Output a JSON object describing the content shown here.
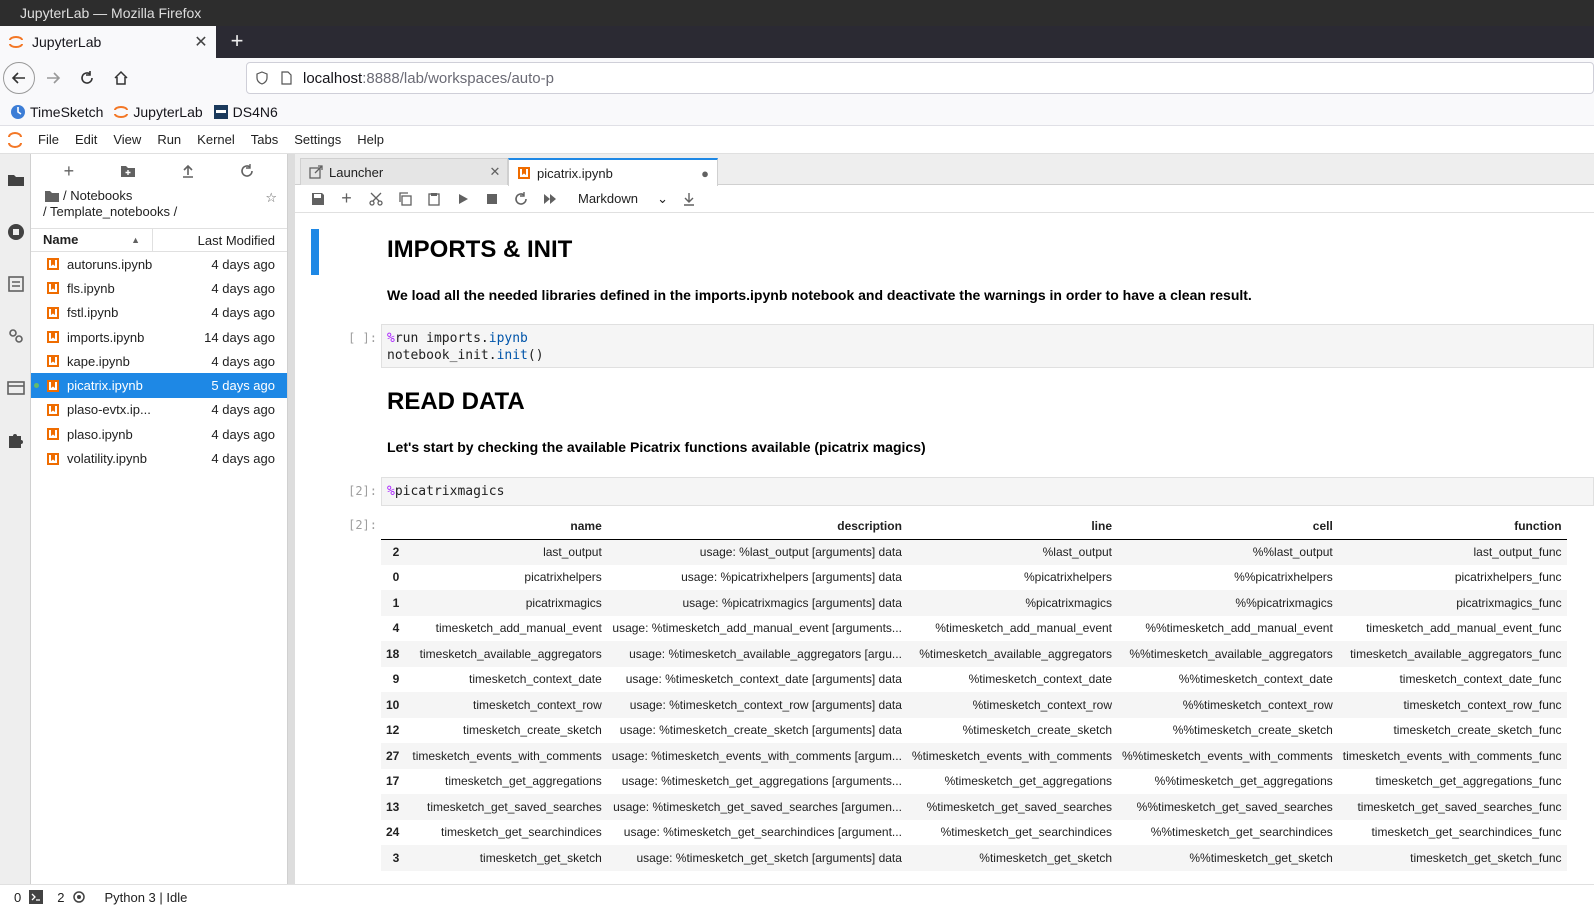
{
  "window": {
    "title": "JupyterLab — Mozilla Firefox"
  },
  "browser": {
    "tab_title": "JupyterLab",
    "url_host": "localhost",
    "url_rest": ":8888/lab/workspaces/auto-p",
    "bookmarks": [
      {
        "label": "TimeSketch",
        "icon": "timesketch-icon"
      },
      {
        "label": "JupyterLab",
        "icon": "jupyter-icon"
      },
      {
        "label": "DS4N6",
        "icon": "ds4n6-icon"
      }
    ]
  },
  "menu": [
    "File",
    "Edit",
    "View",
    "Run",
    "Kernel",
    "Tabs",
    "Settings",
    "Help"
  ],
  "filebrowser": {
    "crumb_line1": "/ Notebooks",
    "crumb_line2": "/ Template_notebooks /",
    "col_name": "Name",
    "col_modified": "Last Modified",
    "files": [
      {
        "name": "autoruns.ipynb",
        "modified": "4 days ago"
      },
      {
        "name": "fls.ipynb",
        "modified": "4 days ago"
      },
      {
        "name": "fstl.ipynb",
        "modified": "4 days ago"
      },
      {
        "name": "imports.ipynb",
        "modified": "14 days ago"
      },
      {
        "name": "kape.ipynb",
        "modified": "4 days ago"
      },
      {
        "name": "picatrix.ipynb",
        "modified": "5 days ago"
      },
      {
        "name": "plaso-evtx.ip...",
        "modified": "4 days ago"
      },
      {
        "name": "plaso.ipynb",
        "modified": "4 days ago"
      },
      {
        "name": "volatility.ipynb",
        "modified": "4 days ago"
      }
    ]
  },
  "doc_tabs": [
    {
      "label": "Launcher"
    },
    {
      "label": "picatrix.ipynb"
    }
  ],
  "notebook": {
    "cell_type": "Markdown",
    "h1_imports": "IMPORTS & INIT",
    "p_imports": "We load all the needed libraries defined in the imports.ipynb notebook and deactivate the warnings in order to have a clean result.",
    "prompt_empty": "[ ]:",
    "code1_magic": "%",
    "code1_a": "run imports.",
    "code1_b": "ipynb",
    "code1_c": "notebook_init.",
    "code1_d": "init",
    "code1_e": "()",
    "h1_read": "READ DATA",
    "p_read": "Let's start by checking the available Picatrix functions available (picatrix magics)",
    "prompt_2": "[2]:",
    "code2_magic": "%",
    "code2_rest": "picatrixmagics",
    "out_prompt": "[2]:"
  },
  "output_table": {
    "columns": [
      "name",
      "description",
      "line",
      "cell",
      "function"
    ],
    "rows": [
      [
        "2",
        "last_output",
        "usage: %last_output [arguments] data",
        "%last_output",
        "%%last_output",
        "last_output_func"
      ],
      [
        "0",
        "picatrixhelpers",
        "usage: %picatrixhelpers [arguments] data",
        "%picatrixhelpers",
        "%%picatrixhelpers",
        "picatrixhelpers_func"
      ],
      [
        "1",
        "picatrixmagics",
        "usage: %picatrixmagics [arguments] data",
        "%picatrixmagics",
        "%%picatrixmagics",
        "picatrixmagics_func"
      ],
      [
        "4",
        "timesketch_add_manual_event",
        "usage: %timesketch_add_manual_event [arguments...",
        "%timesketch_add_manual_event",
        "%%timesketch_add_manual_event",
        "timesketch_add_manual_event_func"
      ],
      [
        "18",
        "timesketch_available_aggregators",
        "usage: %timesketch_available_aggregators [argu...",
        "%timesketch_available_aggregators",
        "%%timesketch_available_aggregators",
        "timesketch_available_aggregators_func"
      ],
      [
        "9",
        "timesketch_context_date",
        "usage: %timesketch_context_date [arguments] data",
        "%timesketch_context_date",
        "%%timesketch_context_date",
        "timesketch_context_date_func"
      ],
      [
        "10",
        "timesketch_context_row",
        "usage: %timesketch_context_row [arguments] data",
        "%timesketch_context_row",
        "%%timesketch_context_row",
        "timesketch_context_row_func"
      ],
      [
        "12",
        "timesketch_create_sketch",
        "usage: %timesketch_create_sketch [arguments] data",
        "%timesketch_create_sketch",
        "%%timesketch_create_sketch",
        "timesketch_create_sketch_func"
      ],
      [
        "27",
        "timesketch_events_with_comments",
        "usage: %timesketch_events_with_comments [argum...",
        "%timesketch_events_with_comments",
        "%%timesketch_events_with_comments",
        "timesketch_events_with_comments_func"
      ],
      [
        "17",
        "timesketch_get_aggregations",
        "usage: %timesketch_get_aggregations [arguments...",
        "%timesketch_get_aggregations",
        "%%timesketch_get_aggregations",
        "timesketch_get_aggregations_func"
      ],
      [
        "13",
        "timesketch_get_saved_searches",
        "usage: %timesketch_get_saved_searches [argumen...",
        "%timesketch_get_saved_searches",
        "%%timesketch_get_saved_searches",
        "timesketch_get_saved_searches_func"
      ],
      [
        "24",
        "timesketch_get_searchindices",
        "usage: %timesketch_get_searchindices [argument...",
        "%timesketch_get_searchindices",
        "%%timesketch_get_searchindices",
        "timesketch_get_searchindices_func"
      ],
      [
        "3",
        "timesketch_get_sketch",
        "usage: %timesketch_get_sketch [arguments] data",
        "%timesketch_get_sketch",
        "%%timesketch_get_sketch",
        "timesketch_get_sketch_func"
      ]
    ]
  },
  "statusbar": {
    "terminals": "0",
    "kernels": "2",
    "kernel_status": "Python 3 | Idle"
  }
}
